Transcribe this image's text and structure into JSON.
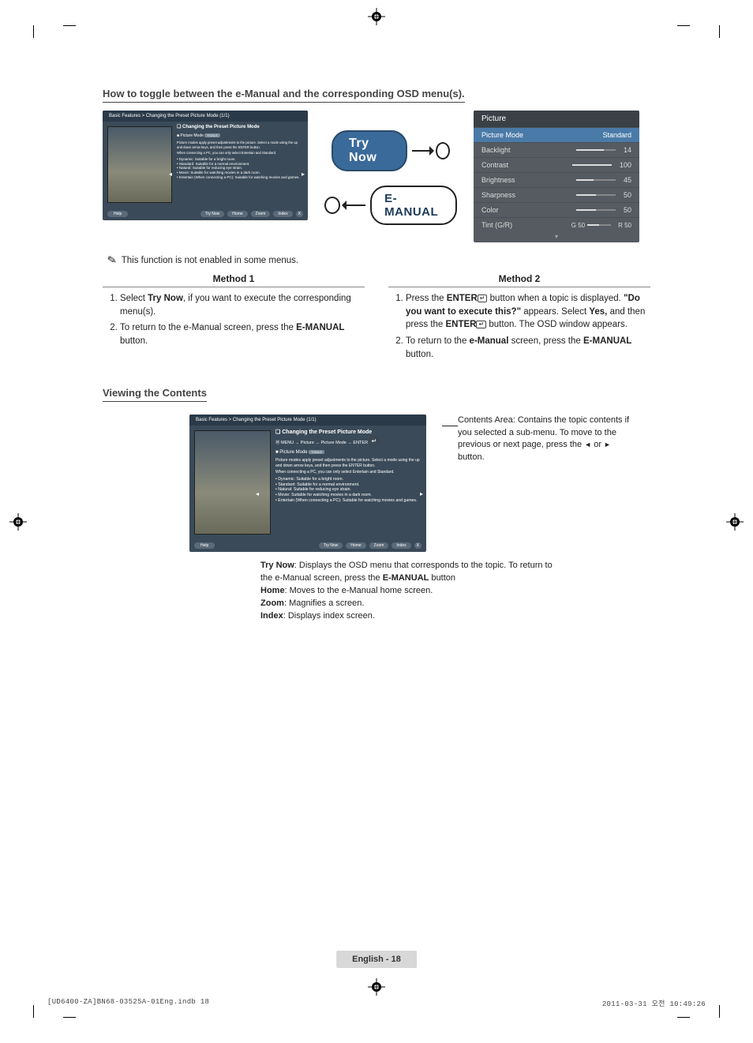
{
  "headings": {
    "toggle_title": "How to toggle between the e-Manual and the corresponding OSD menu(s).",
    "viewing_title": "Viewing the Contents"
  },
  "emanual_small": {
    "breadcrumb": "Basic Features > Changing the Preset Picture Mode (1/1)",
    "h1": "Changing the Preset Picture Mode",
    "h2": "Picture Mode",
    "tools": "TOOLS",
    "line1": "Picture modes apply preset adjustments to the picture. Select a mode using the up and down arrow keys, and then press the ENTER button.",
    "line2": "When connecting a PC, you can only select Entertain and Standard.",
    "b_dynamic": "Dynamic: Suitable for a bright room.",
    "b_standard": "Standard: Suitable for a normal environment.",
    "b_natural": "Natural: Suitable for reducing eye strain.",
    "b_movie": "Movie: Suitable for watching movies in a dark room.",
    "b_entertain": "Entertain (When connecting a PC): Suitable for watching movies and games.",
    "footer": {
      "trynow": "Try Now",
      "home": "Home",
      "zoom": "Zoom",
      "index": "Index",
      "x": "X",
      "help": "Help"
    }
  },
  "pills": {
    "try": "Try Now",
    "emanual": "E-MANUAL"
  },
  "osd": {
    "title": "Picture",
    "rows": [
      {
        "label": "Picture Mode",
        "value": "Standard",
        "fill": 0
      },
      {
        "label": "Backlight",
        "value": "14",
        "fill": 70
      },
      {
        "label": "Contrast",
        "value": "100",
        "fill": 100
      },
      {
        "label": "Brightness",
        "value": "45",
        "fill": 45
      },
      {
        "label": "Sharpness",
        "value": "50",
        "fill": 50
      },
      {
        "label": "Color",
        "value": "50",
        "fill": 50
      }
    ],
    "tint": {
      "label": "Tint (G/R)",
      "g": "G 50",
      "r": "R 50"
    }
  },
  "note": "This function is not enabled in some menus.",
  "method1": {
    "title": "Method 1",
    "s1a": "Select ",
    "s1b": "Try Now",
    "s1c": ", if you want to execute the corresponding menu(s).",
    "s2a": "To return to the e-Manual screen, press the ",
    "s2b": "E-MANUAL",
    "s2c": " button."
  },
  "method2": {
    "title": "Method 2",
    "s1a": "Press the ",
    "s1b": "ENTER",
    "s1c": " button when a topic is displayed. ",
    "s1d": "\"Do you want to execute this?\"",
    "s1e": " appears. Select ",
    "s1f": "Yes,",
    "s1g": " and then press the ",
    "s1h": "ENTER",
    "s1i": " button. The OSD window appears.",
    "s2a": "To return to the ",
    "s2b": "e-Manual",
    "s2c": " screen, press the ",
    "s2d": "E-MANUAL",
    "s2e": " button."
  },
  "emanual_big": {
    "breadcrumb": "Basic Features > Changing the Preset Picture Mode (1/1)",
    "h1": "Changing the Preset Picture Mode",
    "path": "MENU → Picture → Picture Mode → ENTER"
  },
  "callouts": {
    "contents1": "Contents Area: Contains the topic contents if you selected a sub-menu. To move to the previous or next page, press the ",
    "contents2": " or ",
    "contents3": " button.",
    "left_sym": "◄",
    "right_sym": "►",
    "trynow_l": "Try Now",
    "trynow": ": Displays the OSD menu that corresponds to the topic. To return to the e-Manual screen, press the ",
    "trynow_b": "E-MANUAL",
    "trynow_end": " button",
    "home_l": "Home",
    "home": ": Moves to the e-Manual home screen.",
    "zoom_l": "Zoom",
    "zoom": ": Magnifies a screen.",
    "index_l": "Index",
    "index": ": Displays index screen."
  },
  "footer": {
    "pagebar": "English - 18",
    "left": "[UD6400-ZA]BN68-03525A-01Eng.indb   18",
    "right": "2011-03-31   오전 10:49:26"
  },
  "enter_glyph": "↵"
}
